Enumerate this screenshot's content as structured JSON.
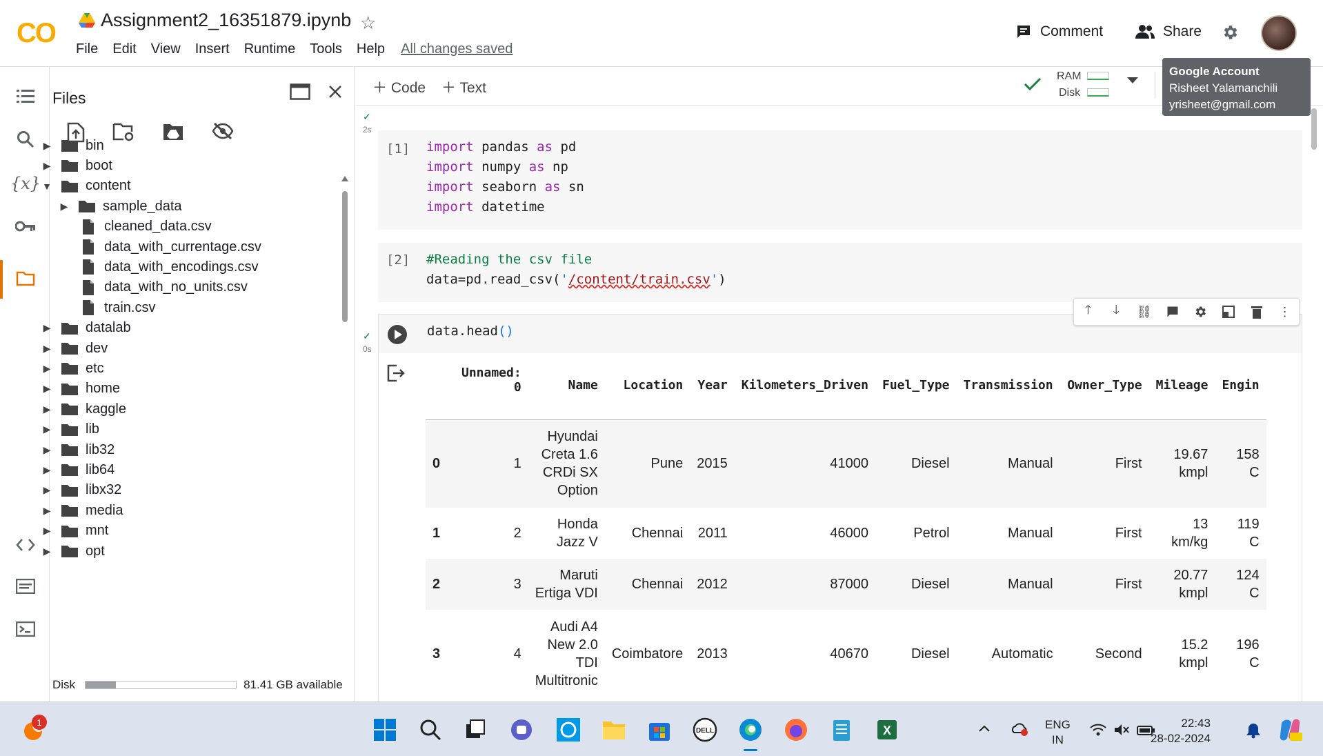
{
  "header": {
    "logo": "CO",
    "notebook_title": "Assignment2_16351879.ipynb",
    "menu": [
      "File",
      "Edit",
      "View",
      "Insert",
      "Runtime",
      "Tools",
      "Help"
    ],
    "saved_status": "All changes saved",
    "comment_label": "Comment",
    "share_label": "Share"
  },
  "tooltip": {
    "title": "Google Account",
    "name": "Risheet Yalamanchili",
    "email": "yrisheet@gmail.com"
  },
  "files": {
    "title": "Files",
    "tree": [
      {
        "name": "bin",
        "type": "folder",
        "level": 0,
        "expanded": false
      },
      {
        "name": "boot",
        "type": "folder",
        "level": 0,
        "expanded": false
      },
      {
        "name": "content",
        "type": "folder",
        "level": 0,
        "expanded": true
      },
      {
        "name": "sample_data",
        "type": "folder",
        "level": 1,
        "expanded": false
      },
      {
        "name": "cleaned_data.csv",
        "type": "file",
        "level": 1
      },
      {
        "name": "data_with_currentage.csv",
        "type": "file",
        "level": 1
      },
      {
        "name": "data_with_encodings.csv",
        "type": "file",
        "level": 1
      },
      {
        "name": "data_with_no_units.csv",
        "type": "file",
        "level": 1
      },
      {
        "name": "train.csv",
        "type": "file",
        "level": 1
      },
      {
        "name": "datalab",
        "type": "folder",
        "level": 0,
        "expanded": false
      },
      {
        "name": "dev",
        "type": "folder",
        "level": 0,
        "expanded": false
      },
      {
        "name": "etc",
        "type": "folder",
        "level": 0,
        "expanded": false
      },
      {
        "name": "home",
        "type": "folder",
        "level": 0,
        "expanded": false
      },
      {
        "name": "kaggle",
        "type": "folder",
        "level": 0,
        "expanded": false
      },
      {
        "name": "lib",
        "type": "folder",
        "level": 0,
        "expanded": false
      },
      {
        "name": "lib32",
        "type": "folder",
        "level": 0,
        "expanded": false
      },
      {
        "name": "lib64",
        "type": "folder",
        "level": 0,
        "expanded": false
      },
      {
        "name": "libx32",
        "type": "folder",
        "level": 0,
        "expanded": false
      },
      {
        "name": "media",
        "type": "folder",
        "level": 0,
        "expanded": false
      },
      {
        "name": "mnt",
        "type": "folder",
        "level": 0,
        "expanded": false
      },
      {
        "name": "opt",
        "type": "folder",
        "level": 0,
        "expanded": false
      }
    ],
    "disk_label": "Disk",
    "disk_available": "81.41 GB available",
    "disk_used_fraction": 0.2
  },
  "toolbar": {
    "code_label": "Code",
    "text_label": "Text",
    "ram_label": "RAM",
    "disk_label": "Disk"
  },
  "cells": {
    "c1": {
      "count": "[1]",
      "time": "2s"
    },
    "c2": {
      "count": "[2]"
    },
    "c3": {
      "time": "0s"
    }
  },
  "dataframe": {
    "columns": [
      "",
      "Unnamed:\n0",
      "Name",
      "Location",
      "Year",
      "Kilometers_Driven",
      "Fuel_Type",
      "Transmission",
      "Owner_Type",
      "Mileage",
      "Engin"
    ],
    "rows": [
      [
        "0",
        "1",
        "Hyundai\nCreta 1.6\nCRDi SX\nOption",
        "Pune",
        "2015",
        "41000",
        "Diesel",
        "Manual",
        "First",
        "19.67\nkmpl",
        "158\nC"
      ],
      [
        "1",
        "2",
        "Honda\nJazz V",
        "Chennai",
        "2011",
        "46000",
        "Petrol",
        "Manual",
        "First",
        "13\nkm/kg",
        "119\nC"
      ],
      [
        "2",
        "3",
        "Maruti\nErtiga VDI",
        "Chennai",
        "2012",
        "87000",
        "Diesel",
        "Manual",
        "First",
        "20.77\nkmpl",
        "124\nC"
      ],
      [
        "3",
        "4",
        "Audi A4\nNew 2.0\nTDI\nMultitronic",
        "Coimbatore",
        "2013",
        "40670",
        "Diesel",
        "Automatic",
        "Second",
        "15.2\nkmpl",
        "196\nC"
      ]
    ]
  },
  "taskbar": {
    "notification_count": "1",
    "lang_line1": "ENG",
    "lang_line2": "IN",
    "time": "22:43",
    "date": "28-02-2024",
    "colors": {
      "accent": "#0078d4",
      "colab_orange": "#e37400",
      "colab_yellow": "#f9ab00"
    }
  }
}
